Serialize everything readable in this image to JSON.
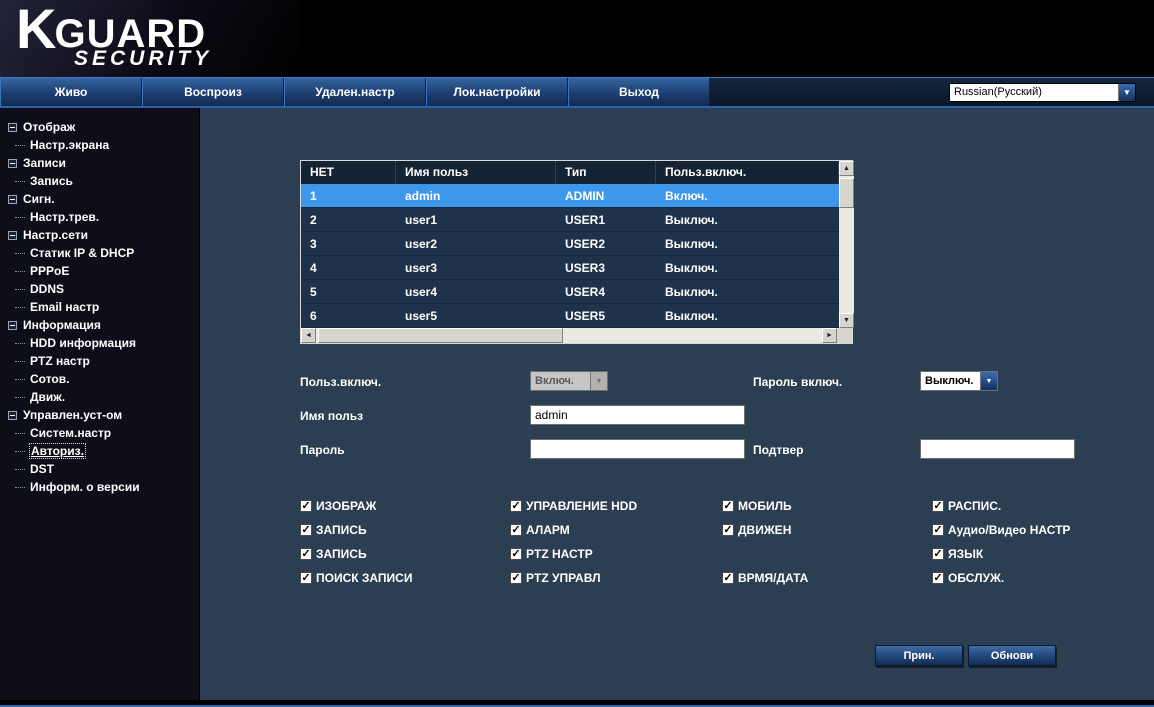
{
  "logo": {
    "k": "K",
    "guard": "GUARD",
    "security": "SECURITY"
  },
  "nav": {
    "items": [
      "Живо",
      "Воспроиз",
      "Удален.настр",
      "Лок.настройки",
      "Выход"
    ]
  },
  "language": {
    "value": "Russian(Русский)"
  },
  "icons": {
    "check": "✓",
    "arrow_down": "▼",
    "scroll_up": "▲",
    "scroll_down": "▼",
    "scroll_left": "◄",
    "scroll_right": "►"
  },
  "colors": {
    "accent_blue": "#3d97ea",
    "nav_blue": "#1d3e72",
    "main_bg": "#2c3e52",
    "sidebar_bg": "#0d0e18"
  },
  "sidebar": {
    "items": [
      {
        "label": "Отображ",
        "level": 0
      },
      {
        "label": "Настр.экрана",
        "level": 1
      },
      {
        "label": "Записи",
        "level": 0
      },
      {
        "label": "Запись",
        "level": 1
      },
      {
        "label": "Сигн.",
        "level": 0
      },
      {
        "label": "Настр.трев.",
        "level": 1
      },
      {
        "label": "Настр.сети",
        "level": 0
      },
      {
        "label": "Статик IP & DHCP",
        "level": 1
      },
      {
        "label": "PPPoE",
        "level": 1
      },
      {
        "label": "DDNS",
        "level": 1
      },
      {
        "label": "Email настр",
        "level": 1
      },
      {
        "label": "Информация",
        "level": 0
      },
      {
        "label": "HDD информация",
        "level": 1
      },
      {
        "label": "PTZ настр",
        "level": 1
      },
      {
        "label": "Сотов.",
        "level": 1
      },
      {
        "label": "Движ.",
        "level": 1
      },
      {
        "label": "Управлен.уст-ом",
        "level": 0
      },
      {
        "label": "Систем.настр",
        "level": 1
      },
      {
        "label": "Авториз.",
        "level": 1,
        "selected": true
      },
      {
        "label": "DST",
        "level": 1
      },
      {
        "label": "Информ. о версии",
        "level": 1
      }
    ]
  },
  "main": {
    "table": {
      "headers": [
        "НЕТ",
        "Имя польз",
        "Тип",
        "Польз.включ."
      ],
      "rows": [
        [
          "1",
          "admin",
          "ADMIN",
          "Включ."
        ],
        [
          "2",
          "user1",
          "USER1",
          "Выключ."
        ],
        [
          "3",
          "user2",
          "USER2",
          "Выключ."
        ],
        [
          "4",
          "user3",
          "USER3",
          "Выключ."
        ],
        [
          "5",
          "user4",
          "USER4",
          "Выключ."
        ],
        [
          "6",
          "user5",
          "USER5",
          "Выключ."
        ]
      ],
      "selected_row_index": 0
    },
    "form": {
      "user_enable_label": "Польз.включ.",
      "user_enable_value": "Включ.",
      "password_enable_label": "Пароль включ.",
      "password_enable_value": "Выключ.",
      "username_label": "Имя польз",
      "username_value": "admin",
      "password_label": "Пароль",
      "confirm_label": "Подтвер"
    },
    "permissions": {
      "rows": [
        [
          "ИЗОБРАЖ",
          "УПРАВЛЕНИЕ HDD",
          "МОБИЛЬ",
          "РАСПИС."
        ],
        [
          "ЗАПИСЬ",
          "АЛАРМ",
          "ДВИЖЕН",
          "Аудио/Видео НАСТР"
        ],
        [
          "ЗАПИСЬ",
          "PTZ НАСТР",
          null,
          "ЯЗЫК"
        ],
        [
          "ПОИСК ЗАПИСИ",
          "PTZ УПРАВЛ",
          "ВРМЯ/ДАТА",
          "ОБСЛУЖ."
        ]
      ]
    },
    "buttons": {
      "apply": "Прин.",
      "refresh": "Обнови"
    }
  }
}
